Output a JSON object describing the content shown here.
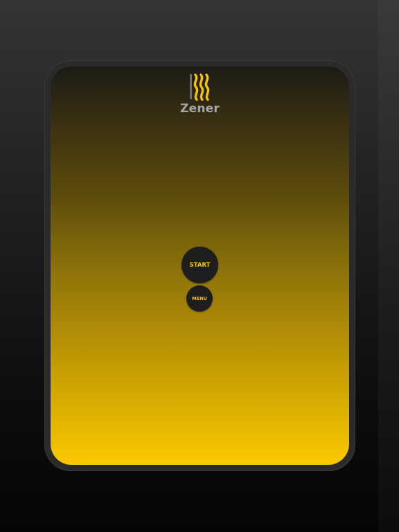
{
  "app": {
    "title": "Zener",
    "logo_icon": "zener-waves-logo-icon"
  },
  "buttons": {
    "start_label": "START",
    "menu_label": "MENU"
  },
  "colors": {
    "accent": "#f5c400",
    "button_bg": "#1e1e1e",
    "title_text": "#a7a7a7",
    "gradient_top": "#1c1a15",
    "gradient_bottom": "#fcc800"
  }
}
